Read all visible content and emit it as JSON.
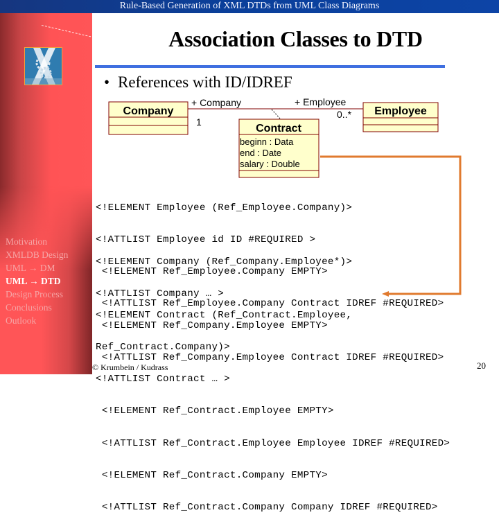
{
  "header": {
    "presentation_title": "Rule-Based Generation of XML DTDs from UML Class Diagrams"
  },
  "sidebar": {
    "logo": "xml-logo-icon",
    "items": [
      {
        "label": "Motivation",
        "active": false
      },
      {
        "label": "XMLDB Design",
        "active": false
      },
      {
        "label": "UML → DM",
        "active": false
      },
      {
        "label": "UML → DTD",
        "active": true
      },
      {
        "label": "Design Process",
        "active": false
      },
      {
        "label": "Conclusions",
        "active": false
      },
      {
        "label": "Outlook",
        "active": false
      }
    ]
  },
  "slide": {
    "title": "Association Classes to DTD",
    "bullet": "References with ID/IDREF",
    "bullet_marker": "•"
  },
  "diagram": {
    "classes": {
      "company": {
        "name": "Company"
      },
      "employee": {
        "name": "Employee"
      },
      "contract": {
        "name": "Contract",
        "attributes": [
          "beginn : Data",
          "end : Date",
          "salary : Double"
        ]
      }
    },
    "association": {
      "company_role": "+ Company",
      "company_multiplicity": "1",
      "employee_role": "+ Employee",
      "employee_multiplicity": "0..*"
    },
    "colors": {
      "class_fill": "#ffffcc",
      "class_border": "#800000",
      "arrow": "#e07a2e",
      "rule": "#3f6fe0"
    }
  },
  "code_blocks": [
    [
      "<!ELEMENT Employee (Ref_Employee.Company)>",
      "<!ATTLIST Employee id ID #REQUIRED >",
      " <!ELEMENT Ref_Employee.Company EMPTY>",
      " <!ATTLIST Ref_Employee.Company Contract IDREF #REQUIRED>"
    ],
    [
      "<!ELEMENT Company (Ref_Company.Employee*)>",
      "<!ATTLIST Company … >",
      " <!ELEMENT Ref_Company.Employee EMPTY>",
      " <!ATTLIST Ref_Company.Employee Contract IDREF #REQUIRED>"
    ],
    [
      "<!ELEMENT Contract (Ref_Contract.Employee,",
      "Ref_Contract.Company)>",
      "<!ATTLIST Contract … >",
      " <!ELEMENT Ref_Contract.Employee EMPTY>",
      " <!ATTLIST Ref_Contract.Employee Employee IDREF #REQUIRED>",
      " <!ELEMENT Ref_Contract.Company EMPTY>",
      " <!ATTLIST Ref_Contract.Company Company IDREF #REQUIRED>"
    ]
  ],
  "footer": {
    "copyright": "© Krumbein / Kudrass",
    "page_number": "20"
  }
}
